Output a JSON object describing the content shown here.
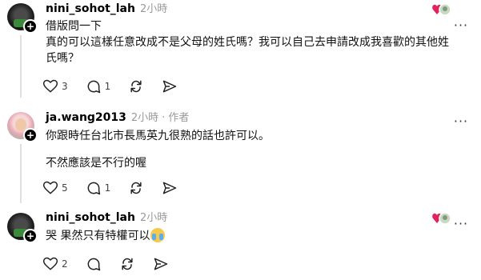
{
  "posts": [
    {
      "username": "nini_sohot_lah",
      "time": "2小時",
      "author_tag": "",
      "lines": [
        "借版問一下",
        "真的可以這樣任意改成不是父母的姓氏嗎？我可以自己去申請改成我喜歡的其他姓",
        "氏嗎？"
      ],
      "likes": "3",
      "replies": "1",
      "avatar_icon": "dark-avatar",
      "reaction_icon": "heart-reaction-icon"
    },
    {
      "username": "ja.wang2013",
      "time": "2小時",
      "author_tag": "作者",
      "lines": [
        "你跟時任台北市長馬英九很熟的話也許可以。",
        "不然應該是不行的喔"
      ],
      "likes": "5",
      "replies": "1",
      "avatar_icon": "pink-avatar",
      "reaction_icon": ""
    },
    {
      "username": "nini_sohot_lah",
      "time": "2小時",
      "author_tag": "",
      "lines": [
        "哭 果然只有特權可以"
      ],
      "likes": "2",
      "replies": "",
      "avatar_icon": "dark-avatar",
      "reaction_icon": "heart-reaction-icon"
    }
  ],
  "separator": "·",
  "more_label": "···",
  "colors": {
    "heart": "#e0245e",
    "meta": "#999999",
    "line": "#e0e0e0"
  }
}
